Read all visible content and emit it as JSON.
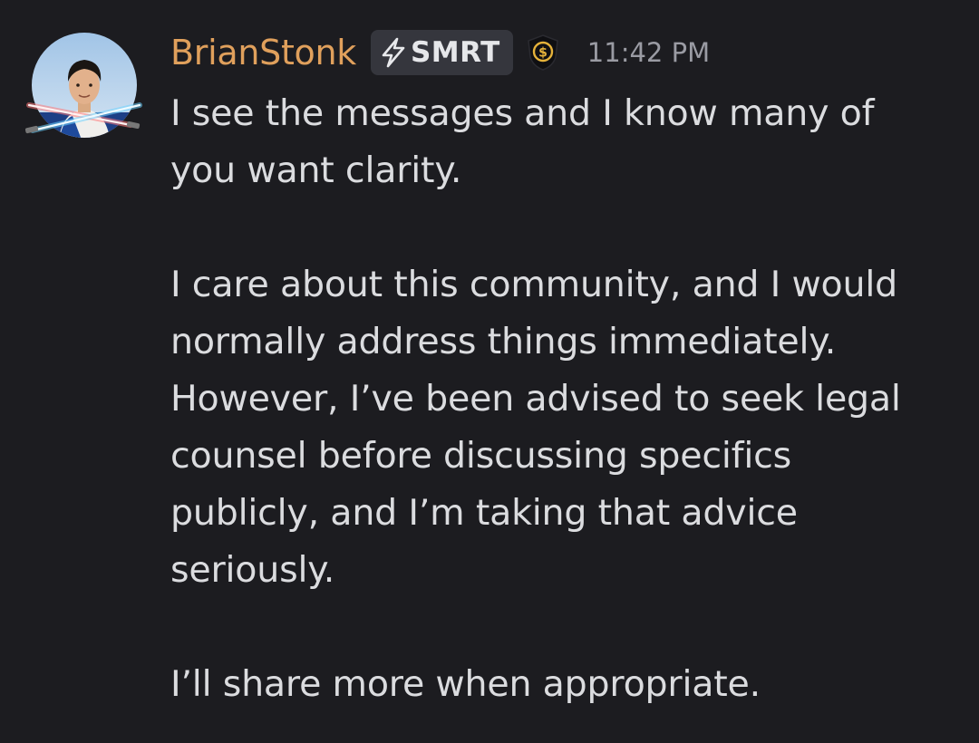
{
  "message": {
    "author": "BrianStonk",
    "tag": {
      "icon": "lightning-bolt-icon",
      "label": "SMRT"
    },
    "role_icon": "dollar-shield-icon",
    "timestamp": "11:42 PM",
    "paragraphs": [
      "I see the messages and I know many of you want clarity.",
      "I care about this community, and I would normally address things immediately. However, I’ve been advised to seek legal counsel before discussing specifics publicly, and I’m taking that advice seriously.",
      "I’ll share more when appropriate."
    ]
  },
  "colors": {
    "background": "#1c1c20",
    "username": "#e0a05c",
    "text": "#dbdcdf",
    "timestamp": "#9a9ba3",
    "tag_background": "#35363d"
  }
}
